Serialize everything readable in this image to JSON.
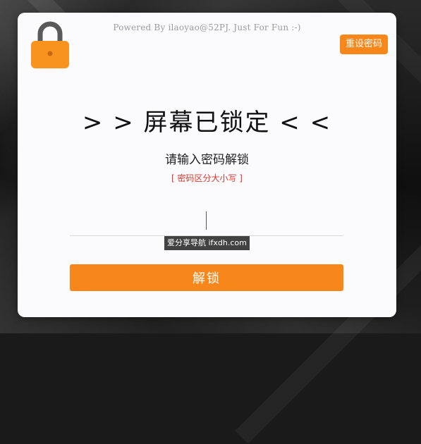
{
  "header": {
    "powered_by": "Powered By ilaoyao@52PJ. Just For Fun :-)",
    "reset_button": "重设密码"
  },
  "lock_screen": {
    "title": "> >  屏幕已锁定  < <",
    "prompt": "请输入密码解锁",
    "hint": "[ 密码区分大小写 ]",
    "password_value": "",
    "unlock_button": "解锁"
  },
  "watermark": {
    "text": "爱分享导航 ifxdh.com"
  },
  "icons": {
    "lock": "lock-icon"
  },
  "colors": {
    "accent": "#f7871a",
    "hint": "#d9362b",
    "card_bg": "#fbfbfd",
    "lock_body": "#f7931e",
    "lock_shackle": "#5a5a5a"
  }
}
